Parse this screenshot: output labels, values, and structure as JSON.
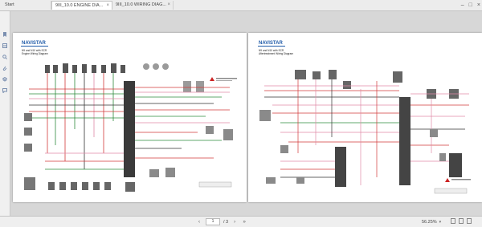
{
  "tabs": [
    {
      "label": "Start",
      "active": false
    },
    {
      "label": "9III_10.0 ENGINE DIA...",
      "active": true
    },
    {
      "label": "9III_10.0 WIRING DIAG...",
      "active": false
    }
  ],
  "sidebar": {
    "icons": [
      "bookmark-icon",
      "thumbnails-icon",
      "search-icon",
      "attachment-icon",
      "layers-icon",
      "comment-icon"
    ]
  },
  "pages": [
    {
      "logo": "NAVISTAR",
      "title_line1": "N9 and N10 with SCR",
      "title_line2": "Engine Wiring Diagram"
    },
    {
      "logo": "NAVISTAR",
      "title_line1": "N9 and N10 with SCR",
      "title_line2": "Aftertreatment Wiring Diagram"
    }
  ],
  "navigation": {
    "current_page": "1",
    "page_count": "/ 3"
  },
  "zoom": {
    "level": "56.25%"
  },
  "colors": {
    "wire_red": "#d23a3a",
    "wire_green": "#2e8b3c",
    "wire_pink": "#e08aa8",
    "wire_black": "#333333",
    "logo_blue": "#1e5aa8",
    "warning_red": "#cc2222"
  }
}
